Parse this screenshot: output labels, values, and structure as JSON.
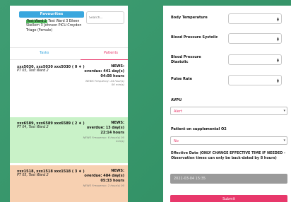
{
  "favourites": {
    "title": "Favourites",
    "search_placeholder": "Search...",
    "wards_selected": "Test Ward 2",
    "wards_rest": " Test Ward 3 Eileen Skellern 3 Johnson PICU Croydon Triage (Female)"
  },
  "tabs": {
    "tasks": "Tasks",
    "patients": "Patients"
  },
  "patients": [
    {
      "name": "xxx5030, xxx5030 xxx5030 ( 0 ♦ )",
      "location": "PT 03, Test Ward 2",
      "news": "NEWS:",
      "overdue": "overdue: 441 day(s) 04:08 hours",
      "freq": "NEWS Frequency: 24 hour(s) 00 min(s)"
    },
    {
      "name": "xxx6589, xxx6589 xxx6589 ( 2 ♦ )",
      "location": "PT 04, Test Ward 2",
      "news": "NEWS:",
      "overdue": "overdue: 13 day(s) 22:14 hours",
      "freq": "NEWS Frequency: 6 hour(s) 00 min(s)"
    },
    {
      "name": "xxx1518, xxx1518 xxx1518 ( 3 ♦ )",
      "location": "PT 05, Test Ward 2",
      "news": "NEWS:",
      "overdue": "overdue: 484 day(s) 05:33 hours",
      "freq": "NEWS Frequency: 2 hour(s) 00"
    }
  ],
  "form": {
    "body_temperature": "Body Temperature",
    "bp_systolic": "Blood Pressure Systolic",
    "bp_diastolic": "Blood Pressure Diastolic",
    "pulse_rate": "Pulse Rate",
    "avpu_label": "AVPU",
    "avpu_value": "Alert",
    "o2_label": "Patient on supplemental O2",
    "o2_value": "No",
    "effective_date_label": "Effective Date (ONLY CHANGE EFFECTIVE TIME IF NEEDED - Observation times can only be back-dated by 8 hours)",
    "effective_date_value": "2021-03-04 15:35",
    "submit": "Submit"
  },
  "colors": {
    "accent_blue": "#3aa7de",
    "accent_pink": "#e8386b",
    "green_row": "#c9f2c8",
    "orange_row": "#f7d0b1"
  }
}
